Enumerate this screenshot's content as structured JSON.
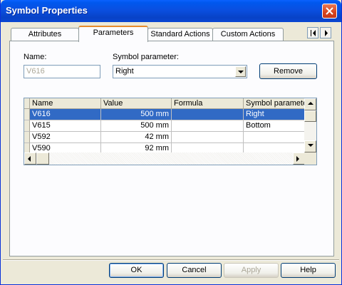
{
  "window": {
    "title": "Symbol Properties"
  },
  "tabs": [
    {
      "label": "Attributes",
      "active": false
    },
    {
      "label": "Parameters",
      "active": true
    },
    {
      "label": "Standard Actions",
      "active": false
    },
    {
      "label": "Custom Actions",
      "active": false
    }
  ],
  "form": {
    "name_label": "Name:",
    "name_value": "V616",
    "symbol_param_label": "Symbol parameter:",
    "symbol_param_value": "Right",
    "remove_label": "Remove"
  },
  "table": {
    "columns": [
      "Name",
      "Value",
      "Formula",
      "Symbol paramete"
    ],
    "rows": [
      {
        "name": "V616",
        "value": "500 mm",
        "formula": "",
        "symbol_param": "Right",
        "selected": true
      },
      {
        "name": "V615",
        "value": "500 mm",
        "formula": "",
        "symbol_param": "Bottom",
        "selected": false
      },
      {
        "name": "V592",
        "value": "42 mm",
        "formula": "",
        "symbol_param": "",
        "selected": false
      },
      {
        "name": "V590",
        "value": "92 mm",
        "formula": "",
        "symbol_param": "",
        "selected": false
      }
    ]
  },
  "buttons": {
    "ok": "OK",
    "cancel": "Cancel",
    "apply": "Apply",
    "help": "Help"
  },
  "colors": {
    "selection": "#316ac5",
    "titlebar": "#0a4fe0",
    "active_tab_accent": "#e68b2c"
  }
}
